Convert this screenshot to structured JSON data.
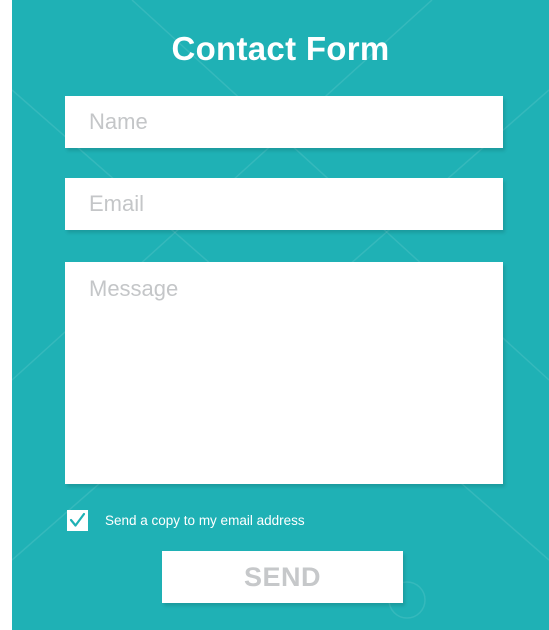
{
  "form": {
    "title": "Contact Form",
    "name_placeholder": "Name",
    "email_placeholder": "Email",
    "message_placeholder": "Message",
    "copy_label": "Send a copy to my email address",
    "copy_checked": true,
    "send_label": "SEND"
  },
  "colors": {
    "panel_background": "#1fb1b5",
    "field_background": "#ffffff",
    "placeholder_text": "#c4c6c8",
    "title_text": "#ffffff"
  },
  "icons": {
    "checkbox": "check-icon"
  }
}
